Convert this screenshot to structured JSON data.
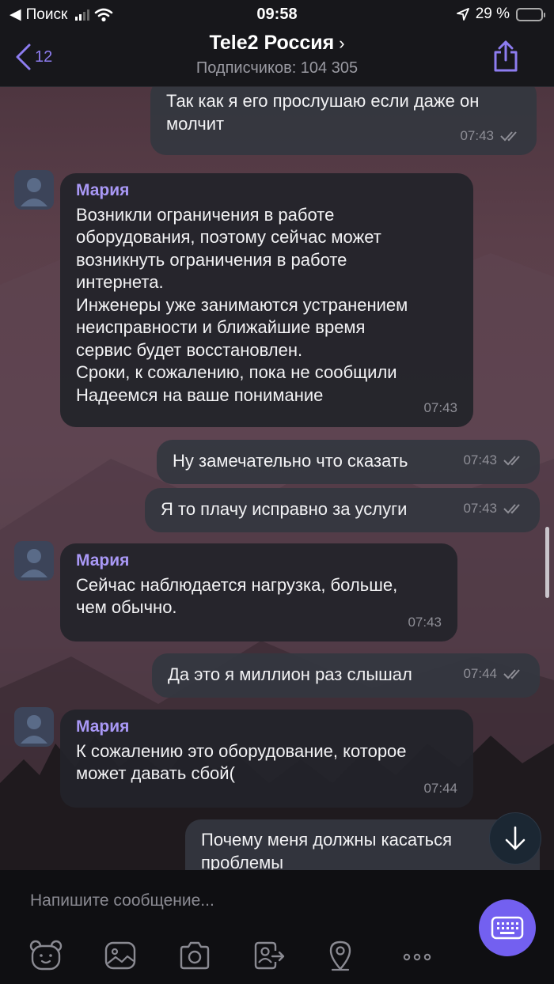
{
  "status_bar": {
    "back_app": "Поиск",
    "time": "09:58",
    "battery_percent": "29 %",
    "battery_level": 0.29
  },
  "header": {
    "back_count": "12",
    "title": "Tele2 Россия",
    "subtitle": "Подписчиков: 104 305"
  },
  "messages": [
    {
      "direction": "out",
      "text": "Так как я его прослушаю если даже он\nмолчит",
      "time": "07:43"
    },
    {
      "direction": "in",
      "sender": "Мария",
      "text": "Возникли ограничения в работе\nоборудования, поэтому сейчас может\nвозникнуть ограничения в работе\nинтернета.\nИнженеры уже занимаются устранением\nнеисправности и ближайшие время\nсервис будет восстановлен.\nСроки, к сожалению, пока не сообщили\nНадеемся на ваше понимание",
      "time": "07:43"
    },
    {
      "direction": "out",
      "text": "Ну замечательно что сказать",
      "time": "07:43"
    },
    {
      "direction": "out",
      "text": "Я то плачу исправно за услуги",
      "time": "07:43"
    },
    {
      "direction": "in",
      "sender": "Мария",
      "text": "Сейчас наблюдается нагрузка, больше,\nчем обычно.",
      "time": "07:43"
    },
    {
      "direction": "out",
      "text": "Да это я миллион раз слышал",
      "time": "07:44"
    },
    {
      "direction": "in",
      "sender": "Мария",
      "text": "К сожалению это оборудование, которое\nможет давать сбой(",
      "time": "07:44"
    },
    {
      "direction": "out",
      "text": "Почему меня должны касаться\nпроблемы",
      "time": ""
    }
  ],
  "composer": {
    "placeholder": "Напишите сообщение...",
    "tools": [
      "sticker-icon",
      "gallery-icon",
      "camera-icon",
      "share-contact-icon",
      "location-icon",
      "more-icon"
    ]
  },
  "colors": {
    "accent": "#7360f0",
    "sender_name": "#a998f6"
  }
}
